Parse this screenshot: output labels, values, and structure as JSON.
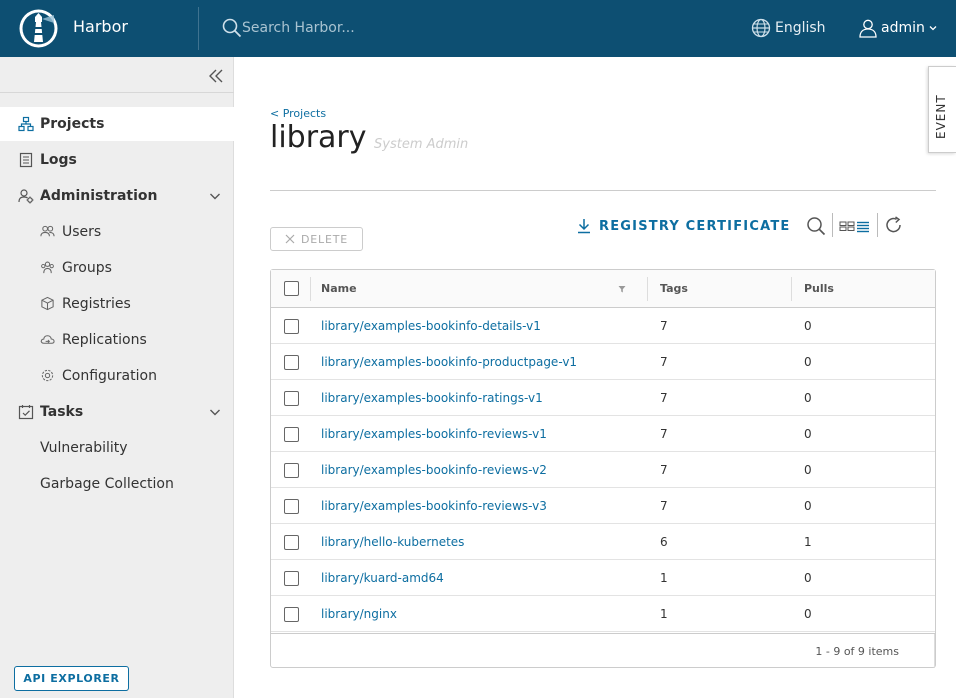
{
  "header": {
    "brand": "Harbor",
    "search_placeholder": "Search Harbor...",
    "language": "English",
    "user": "admin",
    "bg_color": "#0d4f72"
  },
  "sidebar": {
    "items": [
      {
        "label": "Projects",
        "icon": "projects-icon"
      },
      {
        "label": "Logs",
        "icon": "logs-icon"
      },
      {
        "label": "Administration",
        "icon": "administration-icon"
      },
      {
        "label": "Users",
        "icon": "users-icon"
      },
      {
        "label": "Groups",
        "icon": "groups-icon"
      },
      {
        "label": "Registries",
        "icon": "registries-icon"
      },
      {
        "label": "Replications",
        "icon": "replications-icon"
      },
      {
        "label": "Configuration",
        "icon": "configuration-icon"
      },
      {
        "label": "Tasks",
        "icon": "tasks-icon"
      },
      {
        "label": "Vulnerability"
      },
      {
        "label": "Garbage Collection"
      }
    ],
    "api_explorer": "API EXPLORER"
  },
  "main": {
    "breadcrumb": "< Projects",
    "title": "library",
    "role": "System Admin",
    "event_tab": "EVENT",
    "delete_label": "DELETE",
    "registry_certificate": "REGISTRY CERTIFICATE",
    "accent_color": "#0d6ea1"
  },
  "table": {
    "columns": [
      "Name",
      "Tags",
      "Pulls"
    ],
    "rows": [
      {
        "name": "library/examples-bookinfo-details-v1",
        "tags": "7",
        "pulls": "0"
      },
      {
        "name": "library/examples-bookinfo-productpage-v1",
        "tags": "7",
        "pulls": "0"
      },
      {
        "name": "library/examples-bookinfo-ratings-v1",
        "tags": "7",
        "pulls": "0"
      },
      {
        "name": "library/examples-bookinfo-reviews-v1",
        "tags": "7",
        "pulls": "0"
      },
      {
        "name": "library/examples-bookinfo-reviews-v2",
        "tags": "7",
        "pulls": "0"
      },
      {
        "name": "library/examples-bookinfo-reviews-v3",
        "tags": "7",
        "pulls": "0"
      },
      {
        "name": "library/hello-kubernetes",
        "tags": "6",
        "pulls": "1"
      },
      {
        "name": "library/kuard-amd64",
        "tags": "1",
        "pulls": "0"
      },
      {
        "name": "library/nginx",
        "tags": "1",
        "pulls": "0"
      }
    ],
    "footer": "1 - 9 of 9 items"
  }
}
